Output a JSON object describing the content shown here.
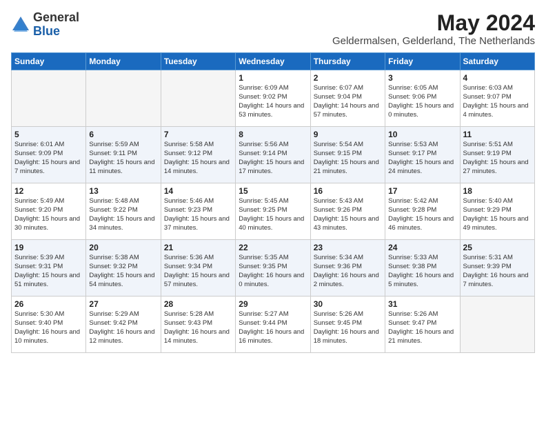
{
  "logo": {
    "general": "General",
    "blue": "Blue"
  },
  "title": {
    "month_year": "May 2024",
    "location": "Geldermalsen, Gelderland, The Netherlands"
  },
  "weekdays": [
    "Sunday",
    "Monday",
    "Tuesday",
    "Wednesday",
    "Thursday",
    "Friday",
    "Saturday"
  ],
  "weeks": [
    [
      {
        "day": "",
        "info": ""
      },
      {
        "day": "",
        "info": ""
      },
      {
        "day": "",
        "info": ""
      },
      {
        "day": "1",
        "info": "Sunrise: 6:09 AM\nSunset: 9:02 PM\nDaylight: 14 hours and 53 minutes."
      },
      {
        "day": "2",
        "info": "Sunrise: 6:07 AM\nSunset: 9:04 PM\nDaylight: 14 hours and 57 minutes."
      },
      {
        "day": "3",
        "info": "Sunrise: 6:05 AM\nSunset: 9:06 PM\nDaylight: 15 hours and 0 minutes."
      },
      {
        "day": "4",
        "info": "Sunrise: 6:03 AM\nSunset: 9:07 PM\nDaylight: 15 hours and 4 minutes."
      }
    ],
    [
      {
        "day": "5",
        "info": "Sunrise: 6:01 AM\nSunset: 9:09 PM\nDaylight: 15 hours and 7 minutes."
      },
      {
        "day": "6",
        "info": "Sunrise: 5:59 AM\nSunset: 9:11 PM\nDaylight: 15 hours and 11 minutes."
      },
      {
        "day": "7",
        "info": "Sunrise: 5:58 AM\nSunset: 9:12 PM\nDaylight: 15 hours and 14 minutes."
      },
      {
        "day": "8",
        "info": "Sunrise: 5:56 AM\nSunset: 9:14 PM\nDaylight: 15 hours and 17 minutes."
      },
      {
        "day": "9",
        "info": "Sunrise: 5:54 AM\nSunset: 9:15 PM\nDaylight: 15 hours and 21 minutes."
      },
      {
        "day": "10",
        "info": "Sunrise: 5:53 AM\nSunset: 9:17 PM\nDaylight: 15 hours and 24 minutes."
      },
      {
        "day": "11",
        "info": "Sunrise: 5:51 AM\nSunset: 9:19 PM\nDaylight: 15 hours and 27 minutes."
      }
    ],
    [
      {
        "day": "12",
        "info": "Sunrise: 5:49 AM\nSunset: 9:20 PM\nDaylight: 15 hours and 30 minutes."
      },
      {
        "day": "13",
        "info": "Sunrise: 5:48 AM\nSunset: 9:22 PM\nDaylight: 15 hours and 34 minutes."
      },
      {
        "day": "14",
        "info": "Sunrise: 5:46 AM\nSunset: 9:23 PM\nDaylight: 15 hours and 37 minutes."
      },
      {
        "day": "15",
        "info": "Sunrise: 5:45 AM\nSunset: 9:25 PM\nDaylight: 15 hours and 40 minutes."
      },
      {
        "day": "16",
        "info": "Sunrise: 5:43 AM\nSunset: 9:26 PM\nDaylight: 15 hours and 43 minutes."
      },
      {
        "day": "17",
        "info": "Sunrise: 5:42 AM\nSunset: 9:28 PM\nDaylight: 15 hours and 46 minutes."
      },
      {
        "day": "18",
        "info": "Sunrise: 5:40 AM\nSunset: 9:29 PM\nDaylight: 15 hours and 49 minutes."
      }
    ],
    [
      {
        "day": "19",
        "info": "Sunrise: 5:39 AM\nSunset: 9:31 PM\nDaylight: 15 hours and 51 minutes."
      },
      {
        "day": "20",
        "info": "Sunrise: 5:38 AM\nSunset: 9:32 PM\nDaylight: 15 hours and 54 minutes."
      },
      {
        "day": "21",
        "info": "Sunrise: 5:36 AM\nSunset: 9:34 PM\nDaylight: 15 hours and 57 minutes."
      },
      {
        "day": "22",
        "info": "Sunrise: 5:35 AM\nSunset: 9:35 PM\nDaylight: 16 hours and 0 minutes."
      },
      {
        "day": "23",
        "info": "Sunrise: 5:34 AM\nSunset: 9:36 PM\nDaylight: 16 hours and 2 minutes."
      },
      {
        "day": "24",
        "info": "Sunrise: 5:33 AM\nSunset: 9:38 PM\nDaylight: 16 hours and 5 minutes."
      },
      {
        "day": "25",
        "info": "Sunrise: 5:31 AM\nSunset: 9:39 PM\nDaylight: 16 hours and 7 minutes."
      }
    ],
    [
      {
        "day": "26",
        "info": "Sunrise: 5:30 AM\nSunset: 9:40 PM\nDaylight: 16 hours and 10 minutes."
      },
      {
        "day": "27",
        "info": "Sunrise: 5:29 AM\nSunset: 9:42 PM\nDaylight: 16 hours and 12 minutes."
      },
      {
        "day": "28",
        "info": "Sunrise: 5:28 AM\nSunset: 9:43 PM\nDaylight: 16 hours and 14 minutes."
      },
      {
        "day": "29",
        "info": "Sunrise: 5:27 AM\nSunset: 9:44 PM\nDaylight: 16 hours and 16 minutes."
      },
      {
        "day": "30",
        "info": "Sunrise: 5:26 AM\nSunset: 9:45 PM\nDaylight: 16 hours and 18 minutes."
      },
      {
        "day": "31",
        "info": "Sunrise: 5:26 AM\nSunset: 9:47 PM\nDaylight: 16 hours and 21 minutes."
      },
      {
        "day": "",
        "info": ""
      }
    ]
  ]
}
